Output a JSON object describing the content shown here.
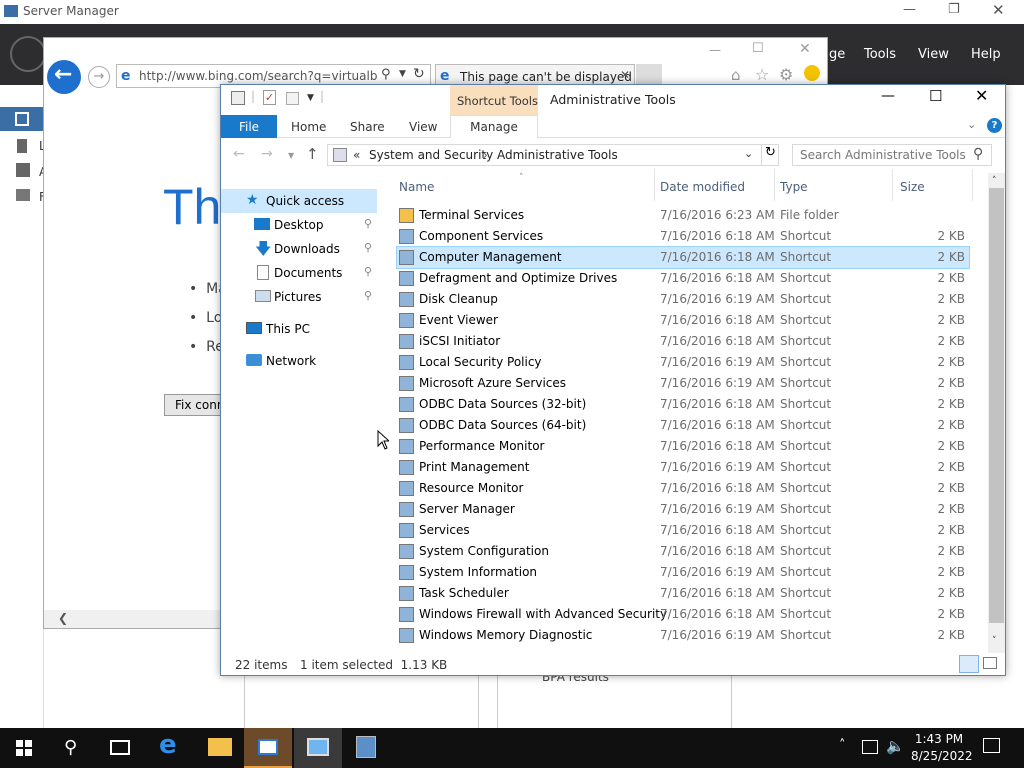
{
  "server_manager": {
    "title": "Server Manager",
    "menu": [
      "ge",
      "Tools",
      "View",
      "Help"
    ],
    "left_letters": [
      "L",
      "A",
      "F"
    ],
    "bpa": "BPA results"
  },
  "ie": {
    "address": "http://www.bing.com/search?q=virtualbox+",
    "tab_title": "This page can't be displayed",
    "heading_fragment": "Th",
    "bullets": [
      "Ma",
      "Lo",
      "Re"
    ],
    "fix_button": "Fix conn"
  },
  "explorer": {
    "ribbon_context": "Shortcut Tools",
    "window_title": "Administrative Tools",
    "tabs": [
      "File",
      "Home",
      "Share",
      "View",
      "Manage"
    ],
    "breadcrumb": [
      "«",
      "System and Security",
      "Administrative Tools"
    ],
    "search_placeholder": "Search Administrative Tools",
    "columns": [
      "Name",
      "Date modified",
      "Type",
      "Size"
    ],
    "nav": {
      "quick_access": "Quick access",
      "desktop": "Desktop",
      "downloads": "Downloads",
      "documents": "Documents",
      "pictures": "Pictures",
      "this_pc": "This PC",
      "network": "Network"
    },
    "files": [
      {
        "name": "Terminal Services",
        "date": "7/16/2016 6:23 AM",
        "type": "File folder",
        "size": ""
      },
      {
        "name": "Component Services",
        "date": "7/16/2016 6:18 AM",
        "type": "Shortcut",
        "size": "2 KB"
      },
      {
        "name": "Computer Management",
        "date": "7/16/2016 6:18 AM",
        "type": "Shortcut",
        "size": "2 KB"
      },
      {
        "name": "Defragment and Optimize Drives",
        "date": "7/16/2016 6:18 AM",
        "type": "Shortcut",
        "size": "2 KB"
      },
      {
        "name": "Disk Cleanup",
        "date": "7/16/2016 6:19 AM",
        "type": "Shortcut",
        "size": "2 KB"
      },
      {
        "name": "Event Viewer",
        "date": "7/16/2016 6:18 AM",
        "type": "Shortcut",
        "size": "2 KB"
      },
      {
        "name": "iSCSI Initiator",
        "date": "7/16/2016 6:18 AM",
        "type": "Shortcut",
        "size": "2 KB"
      },
      {
        "name": "Local Security Policy",
        "date": "7/16/2016 6:19 AM",
        "type": "Shortcut",
        "size": "2 KB"
      },
      {
        "name": "Microsoft Azure Services",
        "date": "7/16/2016 6:19 AM",
        "type": "Shortcut",
        "size": "2 KB"
      },
      {
        "name": "ODBC Data Sources (32-bit)",
        "date": "7/16/2016 6:18 AM",
        "type": "Shortcut",
        "size": "2 KB"
      },
      {
        "name": "ODBC Data Sources (64-bit)",
        "date": "7/16/2016 6:18 AM",
        "type": "Shortcut",
        "size": "2 KB"
      },
      {
        "name": "Performance Monitor",
        "date": "7/16/2016 6:18 AM",
        "type": "Shortcut",
        "size": "2 KB"
      },
      {
        "name": "Print Management",
        "date": "7/16/2016 6:19 AM",
        "type": "Shortcut",
        "size": "2 KB"
      },
      {
        "name": "Resource Monitor",
        "date": "7/16/2016 6:18 AM",
        "type": "Shortcut",
        "size": "2 KB"
      },
      {
        "name": "Server Manager",
        "date": "7/16/2016 6:19 AM",
        "type": "Shortcut",
        "size": "2 KB"
      },
      {
        "name": "Services",
        "date": "7/16/2016 6:18 AM",
        "type": "Shortcut",
        "size": "2 KB"
      },
      {
        "name": "System Configuration",
        "date": "7/16/2016 6:18 AM",
        "type": "Shortcut",
        "size": "2 KB"
      },
      {
        "name": "System Information",
        "date": "7/16/2016 6:19 AM",
        "type": "Shortcut",
        "size": "2 KB"
      },
      {
        "name": "Task Scheduler",
        "date": "7/16/2016 6:18 AM",
        "type": "Shortcut",
        "size": "2 KB"
      },
      {
        "name": "Windows Firewall with Advanced Security",
        "date": "7/16/2016 6:18 AM",
        "type": "Shortcut",
        "size": "2 KB"
      },
      {
        "name": "Windows Memory Diagnostic",
        "date": "7/16/2016 6:19 AM",
        "type": "Shortcut",
        "size": "2 KB"
      }
    ],
    "selected_index": 2,
    "status_count": "22 items",
    "status_selected": "1 item selected  1.13 KB"
  },
  "taskbar": {
    "time": "1:43 PM",
    "date": "8/25/2022"
  }
}
